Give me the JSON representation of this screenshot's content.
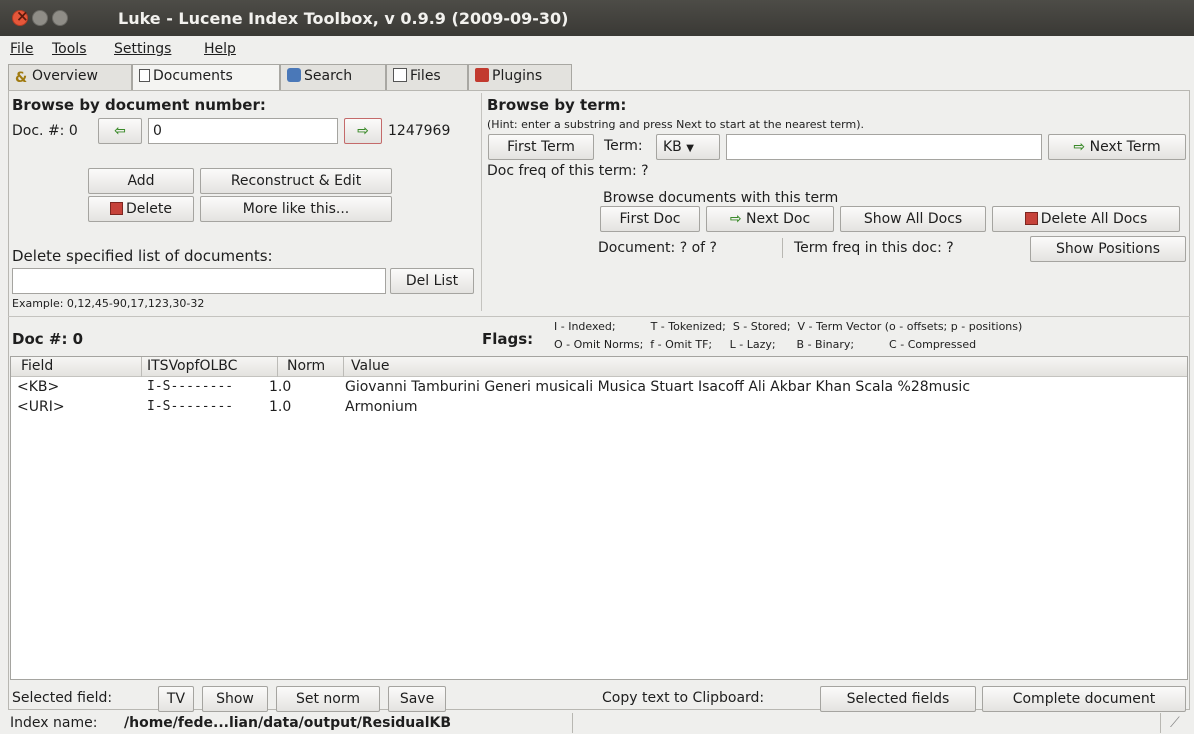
{
  "window": {
    "title": "Luke - Lucene Index Toolbox, v 0.9.9 (2009-09-30)"
  },
  "menu": [
    {
      "label": "File"
    },
    {
      "label": "Tools"
    },
    {
      "label": "Settings"
    },
    {
      "label": "Help"
    }
  ],
  "tabs": [
    {
      "label": "Overview",
      "icon": "overview-icon"
    },
    {
      "label": "Documents",
      "icon": "documents-icon",
      "active": true
    },
    {
      "label": "Search",
      "icon": "search-icon"
    },
    {
      "label": "Files",
      "icon": "files-icon"
    },
    {
      "label": "Plugins",
      "icon": "plugins-icon"
    }
  ],
  "browse_doc": {
    "heading": "Browse by document number:",
    "doc_label": "Doc. #: 0",
    "doc_value": "0",
    "max_doc": "1247969",
    "add": "Add",
    "reconstruct": "Reconstruct & Edit",
    "delete": "Delete",
    "more_like": "More like this...",
    "delete_list_label": "Delete specified list of documents:",
    "del_list": "Del List",
    "example": "Example: 0,12,45-90,17,123,30-32"
  },
  "browse_term": {
    "heading": "Browse by term:",
    "hint": "(Hint: enter a substring and press Next to start at the nearest term).",
    "first_term": "First Term",
    "term_label": "Term:",
    "term_field": "KB",
    "next_term": "Next Term",
    "doc_freq": "Doc freq of this term: ?",
    "browse_docs": "Browse documents with this term",
    "first_doc": "First Doc",
    "next_doc": "Next Doc",
    "show_all": "Show All Docs",
    "delete_all": "Delete All Docs",
    "document_label": "Document: ?  of  ?",
    "term_freq": "Term freq in this doc: ?",
    "show_positions": "Show Positions"
  },
  "doc_info": {
    "doc_num": "Doc #: 0",
    "flags_label": "Flags:",
    "flags_line1": "I - Indexed;          T - Tokenized;  S - Stored;  V - Term Vector (o - offsets; p - positions)",
    "flags_line2": "O - Omit Norms;  f - Omit TF;     L - Lazy;      B - Binary;          C - Compressed"
  },
  "table": {
    "columns": [
      "Field",
      "ITSVopfOLBC",
      "Norm",
      "Value"
    ],
    "rows": [
      {
        "field": "<KB>",
        "flags": "I-S--------",
        "norm": "1.0",
        "value": "Giovanni Tamburini Generi musicali Musica Stuart Isacoff Ali Akbar Khan Scala %28music"
      },
      {
        "field": "<URI>",
        "flags": "I-S--------",
        "norm": "1.0",
        "value": "Armonium"
      }
    ]
  },
  "bottom": {
    "selected_field": "Selected field:",
    "tv": "TV",
    "show": "Show",
    "set_norm": "Set norm",
    "save": "Save",
    "copy_label": "Copy text to Clipboard:",
    "selected_fields": "Selected fields",
    "complete_doc": "Complete document"
  },
  "status": {
    "label": "Index name:",
    "path": "/home/fede...lian/data/output/ResidualKB"
  }
}
